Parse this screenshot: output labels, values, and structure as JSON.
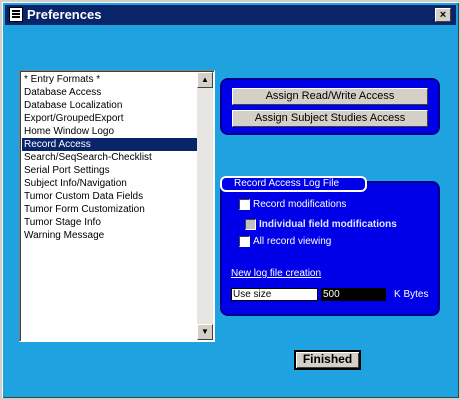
{
  "window": {
    "title": "Preferences",
    "close_label": "×"
  },
  "list": {
    "items": [
      "* Entry Formats *",
      "Database Access",
      "Database Localization",
      "Export/GroupedExport",
      "Home Window Logo",
      "Record Access",
      "Search/SeqSearch-Checklist",
      "Serial Port Settings",
      "Subject Info/Navigation",
      "Tumor Custom Data Fields",
      "Tumor Form Customization",
      "Tumor Stage Info",
      "Warning Message"
    ],
    "selected": "Record Access"
  },
  "access": {
    "rw_label": "Assign Read/Write Access",
    "ss_label": "Assign Subject Studies Access"
  },
  "log": {
    "group_label": "Record Access Log File",
    "record_mod": "Record modifications",
    "indiv_mod": "Individual field modifications",
    "all_view": "All record viewing",
    "new_log": "New log file creation",
    "use_size": "Use size",
    "size_value": "500",
    "size_unit": "K Bytes"
  },
  "footer": {
    "finished_label": "Finished"
  },
  "colors": {
    "background": "#1fa3e0",
    "panel": "#0000e8",
    "title_bar": "#0a246a"
  }
}
